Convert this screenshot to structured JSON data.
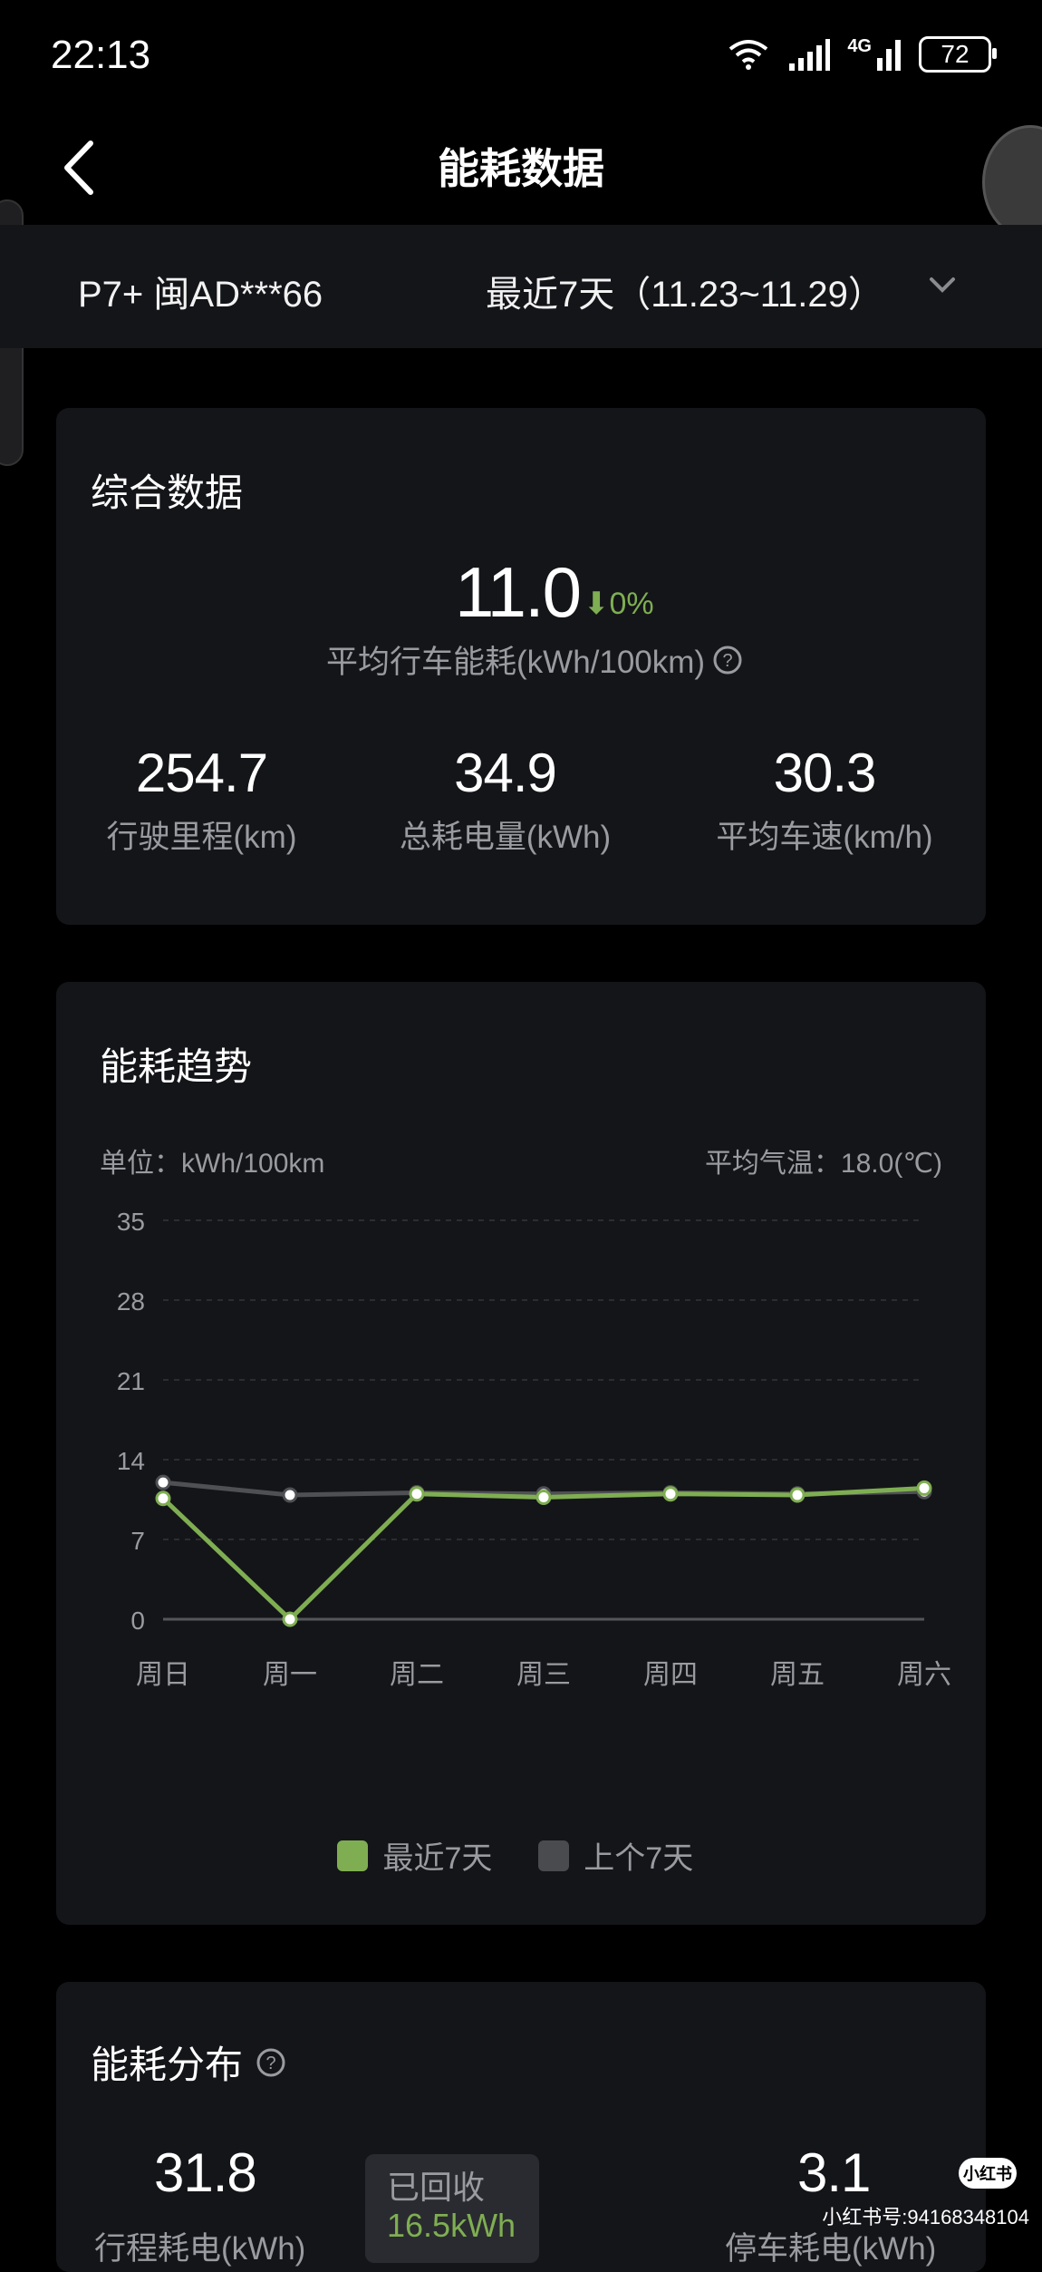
{
  "status": {
    "time": "22:13",
    "battery": "72",
    "network": "4G"
  },
  "header": {
    "title": "能耗数据"
  },
  "selector": {
    "car": "P7+ 闽AD***66",
    "range": "最近7天（11.23~11.29）"
  },
  "summary": {
    "title": "综合数据",
    "avg_value": "11.0",
    "change": "0%",
    "avg_label": "平均行车能耗(kWh/100km)",
    "stats": [
      {
        "value": "254.7",
        "label": "行驶里程(km)"
      },
      {
        "value": "34.9",
        "label": "总耗电量(kWh)"
      },
      {
        "value": "30.3",
        "label": "平均车速(km/h)"
      }
    ]
  },
  "trend": {
    "title": "能耗趋势",
    "unit": "单位：kWh/100km",
    "temp": "平均气温：18.0(℃)",
    "legend": {
      "recent": "最近7天",
      "previous": "上个7天"
    },
    "colors": {
      "recent": "#7fae52",
      "previous": "#4a4b4e"
    }
  },
  "chart_data": {
    "type": "line",
    "categories": [
      "周日",
      "周一",
      "周二",
      "周三",
      "周四",
      "周五",
      "周六"
    ],
    "series": [
      {
        "name": "最近7天",
        "values": [
          10.6,
          0,
          11.0,
          10.7,
          11.0,
          10.9,
          11.5
        ]
      },
      {
        "name": "上个7天",
        "values": [
          12.0,
          10.9,
          11.1,
          11.0,
          11.1,
          11.0,
          11.2
        ]
      }
    ],
    "yticks": [
      "35",
      "28",
      "21",
      "14",
      "7",
      "0"
    ],
    "ylim": [
      0,
      35
    ],
    "ylabel": "单位：kWh/100km",
    "grid": true,
    "legend": "bottom"
  },
  "distribution": {
    "title": "能耗分布",
    "trip_value": "31.8",
    "trip_label": "行程耗电(kWh)",
    "recovered_label": "已回收",
    "recovered_value": "16.5kWh",
    "parking_value": "3.1",
    "parking_label": "停车耗电(kWh)"
  },
  "watermark": {
    "text": "小红书号:94168348104",
    "logo": "小红书"
  }
}
